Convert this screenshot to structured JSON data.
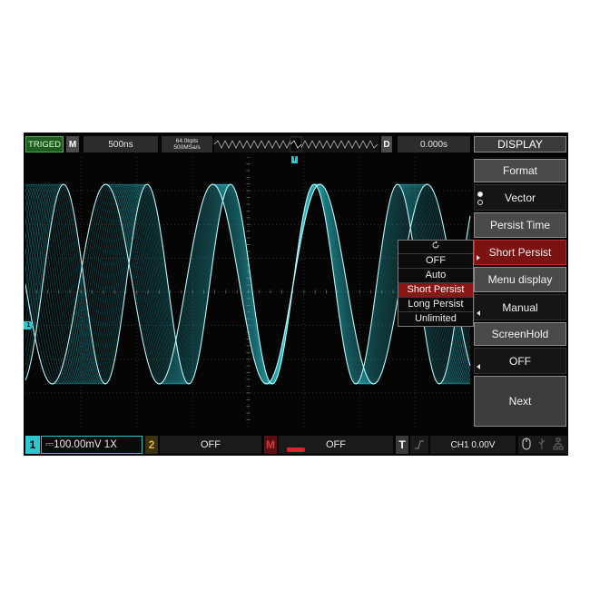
{
  "topbar": {
    "trig_status": "TRIGED",
    "m_label": "M",
    "timebase": "500ns",
    "memory_depth": "64.0kpts",
    "sample_rate": "500MSa/s",
    "d_label": "D",
    "delay": "0.000s",
    "menu_title": "DISPLAY"
  },
  "markers": {
    "trigger": "T",
    "ch1": "1"
  },
  "menu": {
    "format_label": "Format",
    "format_value": "Vector",
    "persist_label": "Persist Time",
    "persist_value": "Short Persist",
    "menu_display_label": "Menu display",
    "menu_display_value": "Manual",
    "screenhold_label": "ScreenHold",
    "screenhold_value": "OFF",
    "next_label": "Next"
  },
  "persist_popup": {
    "icon": "rotate-knob-icon",
    "options": [
      "OFF",
      "Auto",
      "Short Persist",
      "Long Persist",
      "Unlimited"
    ],
    "selected": "Short Persist"
  },
  "bottombar": {
    "ch1_num": "1",
    "ch1_settings": "⎓100.00mV  1X",
    "ch2_num": "2",
    "ch2_status": "OFF",
    "math_label": "M",
    "math_status": "OFF",
    "trig_label": "T",
    "trig_slope_icon": "rising-edge-icon",
    "trig_value": "CH1  0.00V",
    "status_icons": [
      "mouse-icon",
      "usb-icon",
      "network-icon"
    ]
  },
  "colors": {
    "ch1": "#2dc7cf",
    "ch2": "#e3b92b",
    "math": "#d43a3a",
    "selected": "#8a1515",
    "triged": "#1f5c1f"
  }
}
